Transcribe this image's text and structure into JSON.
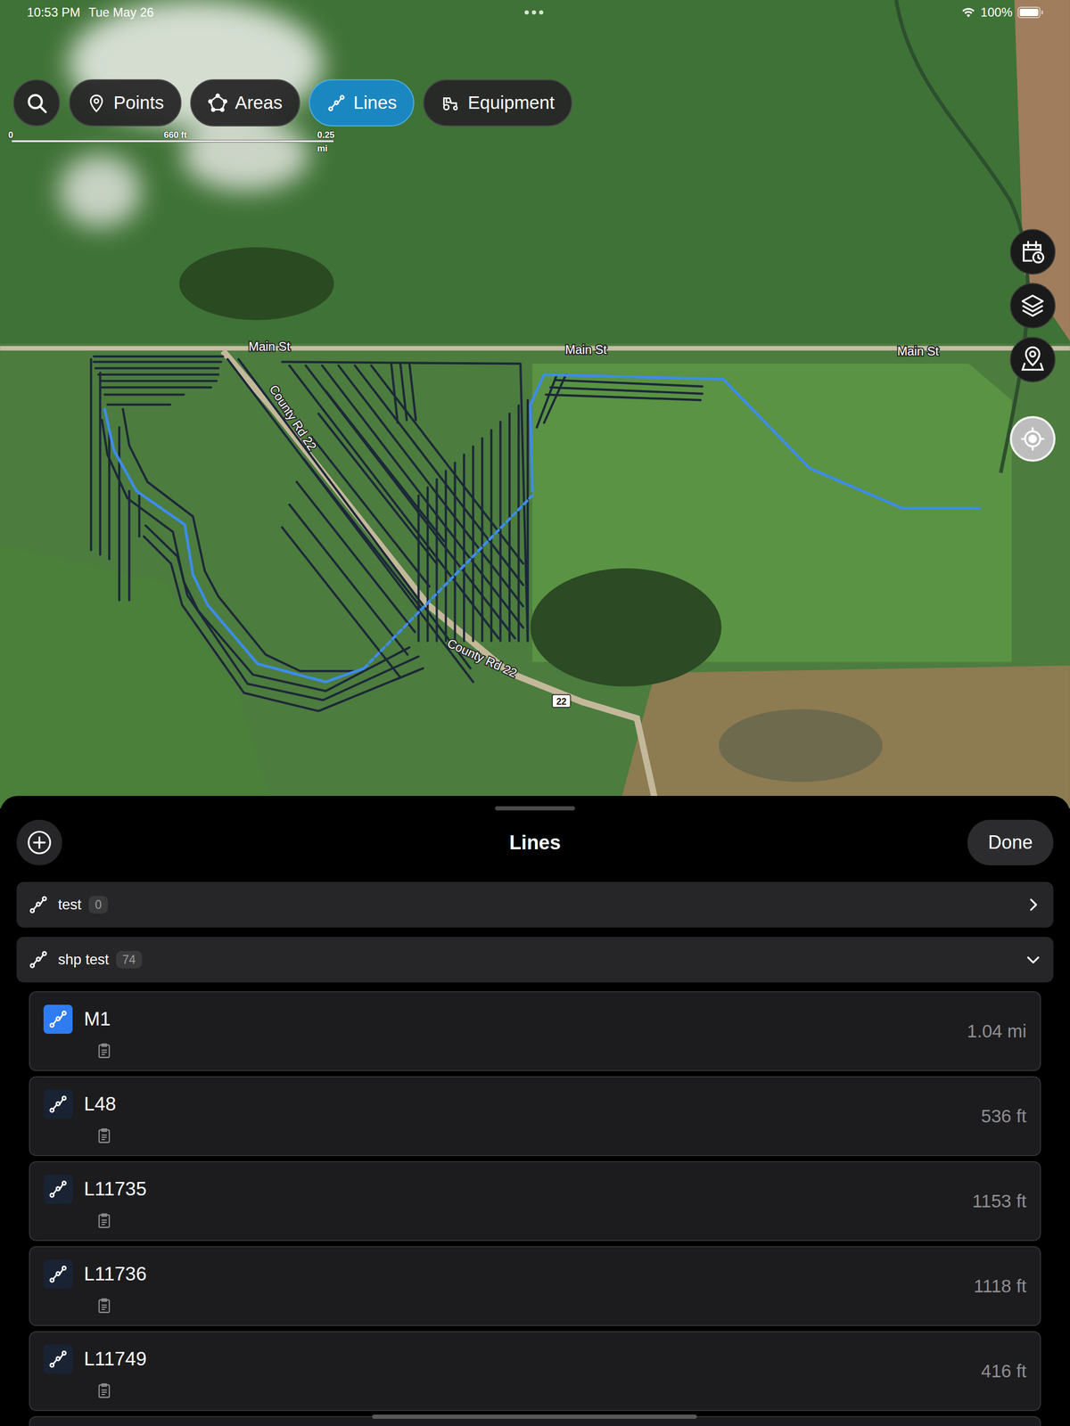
{
  "status_bar": {
    "time": "10:53 PM",
    "date": "Tue May 26",
    "battery": "100%"
  },
  "toolbar": {
    "filters": [
      {
        "label": "Points",
        "selected": false
      },
      {
        "label": "Areas",
        "selected": false
      },
      {
        "label": "Lines",
        "selected": true
      },
      {
        "label": "Equipment",
        "selected": false
      }
    ]
  },
  "scale_bar": {
    "ticks": [
      "0",
      "660 ft",
      "0.25 mi"
    ]
  },
  "map": {
    "road_labels": [
      "Main St",
      "Main St",
      "Main St",
      "County Rd 22",
      "County Rd 22"
    ],
    "route_shield": "22"
  },
  "sheet": {
    "title": "Lines",
    "done": "Done",
    "groups": [
      {
        "name": "test",
        "count": "0",
        "expanded": false,
        "items": []
      },
      {
        "name": "shp test",
        "count": "74",
        "expanded": true,
        "items": [
          {
            "name": "M1",
            "length": "1.04 mi",
            "selected": true
          },
          {
            "name": "L48",
            "length": "536 ft",
            "selected": false
          },
          {
            "name": "L11735",
            "length": "1153 ft",
            "selected": false
          },
          {
            "name": "L11736",
            "length": "1118 ft",
            "selected": false
          },
          {
            "name": "L11749",
            "length": "416 ft",
            "selected": false
          }
        ]
      }
    ]
  }
}
